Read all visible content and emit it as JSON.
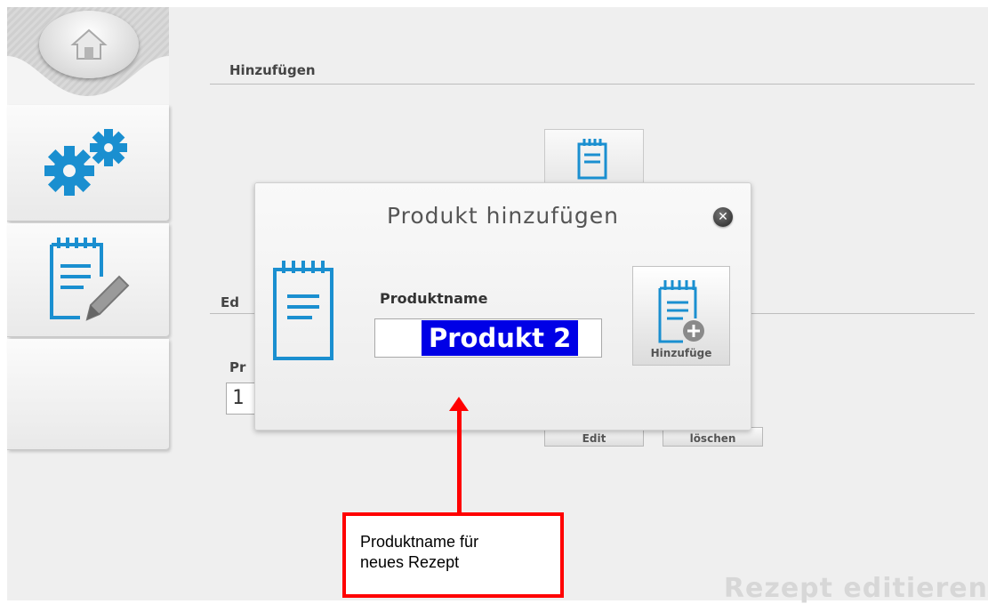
{
  "sidebar": {
    "items": [
      {
        "name": "home",
        "icon": "home-icon"
      },
      {
        "name": "settings",
        "icon": "gears-icon"
      },
      {
        "name": "recipe",
        "icon": "notepad-edit-icon"
      },
      {
        "name": "empty"
      }
    ]
  },
  "main": {
    "section_add_title": "Hinzufügen",
    "section_edit_title_partial": "Ed",
    "field_partial_label": "Pr",
    "field_partial_value": "1",
    "edit_button": "Edit",
    "delete_button": "löschen",
    "watermark": "Rezept editieren"
  },
  "dialog": {
    "title": "Produkt hinzufügen",
    "field_label": "Produktname",
    "field_value": "Produkt 2",
    "add_button_label": "Hinzufüge",
    "close_symbol": "✕"
  },
  "annotation": {
    "callout_line1": "Produktname für",
    "callout_line2": "neues Rezept"
  },
  "colors": {
    "accent_blue": "#1a8fd0",
    "selection": "#0000e6",
    "annotation_red": "#ff0000"
  }
}
